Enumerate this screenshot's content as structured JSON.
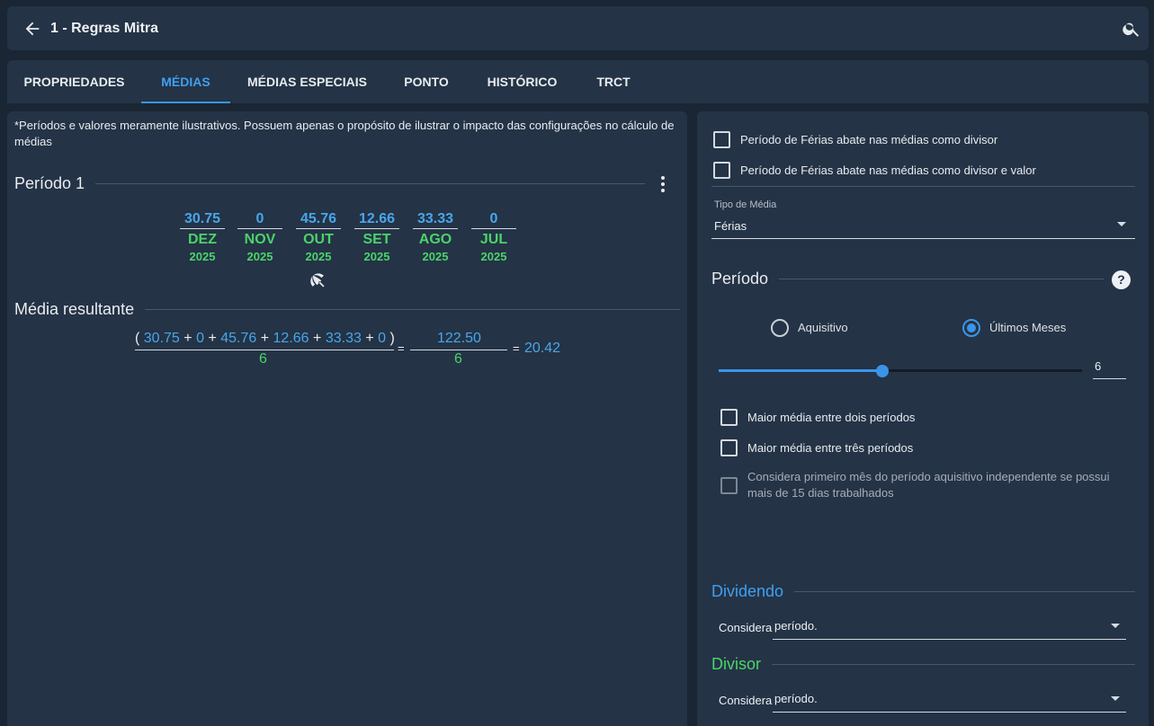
{
  "header": {
    "title": "1 - Regras Mitra"
  },
  "tabs": [
    {
      "label": "PROPRIEDADES"
    },
    {
      "label": "MÉDIAS"
    },
    {
      "label": "MÉDIAS ESPECIAIS"
    },
    {
      "label": "PONTO"
    },
    {
      "label": "HISTÓRICO"
    },
    {
      "label": "TRCT"
    }
  ],
  "active_tab": "MÉDIAS",
  "left": {
    "note": "*Períodos e valores meramente ilustrativos. Possuem apenas o propósito de ilustrar o impacto das configurações no cálculo de médias",
    "period_title": "Período 1",
    "months": [
      {
        "value": "30.75",
        "month": "DEZ",
        "year": "2025"
      },
      {
        "value": "0",
        "month": "NOV",
        "year": "2025"
      },
      {
        "value": "45.76",
        "month": "OUT",
        "year": "2025"
      },
      {
        "value": "12.66",
        "month": "SET",
        "year": "2025"
      },
      {
        "value": "33.33",
        "month": "AGO",
        "year": "2025"
      },
      {
        "value": "0",
        "month": "JUL",
        "year": "2025"
      }
    ],
    "result_title": "Média resultante",
    "formula": {
      "open": "(",
      "close": ")",
      "plus": "+",
      "terms": [
        "30.75",
        "0",
        "45.76",
        "12.66",
        "33.33",
        "0"
      ],
      "denominator": "6",
      "equals": "=",
      "sum": "122.50",
      "sum_denominator": "6",
      "result": "20.42"
    }
  },
  "right": {
    "cb_ferias_divisor": "Período de Férias abate nas médias como divisor",
    "cb_ferias_divisor_valor": "Período de Férias abate nas médias como divisor e valor",
    "tipo_media": {
      "label": "Tipo de Média",
      "value": "Férias"
    },
    "periodo_title": "Período",
    "help_glyph": "?",
    "radio_aquisitivo": "Aquisitivo",
    "radio_ultimos": "Últimos Meses",
    "selected_radio": "Últimos Meses",
    "slider": {
      "value": "6",
      "fraction": 0.45
    },
    "cb_maior_dois": "Maior média entre dois períodos",
    "cb_maior_tres": "Maior média entre três períodos",
    "cb_considera_primeiro": "Considera primeiro mês do período aquisitivo independente se possui mais de 15 dias trabalhados",
    "dividendo": {
      "title": "Dividendo",
      "prefix": "Considera",
      "value": "período."
    },
    "divisor": {
      "title": "Divisor",
      "prefix": "Considera",
      "value": "período."
    }
  },
  "colors": {
    "accent": "#3a95e8",
    "value_blue": "#48a6ea",
    "month_green": "#4cd36a",
    "panel": "#243346",
    "background": "#1a2634"
  }
}
